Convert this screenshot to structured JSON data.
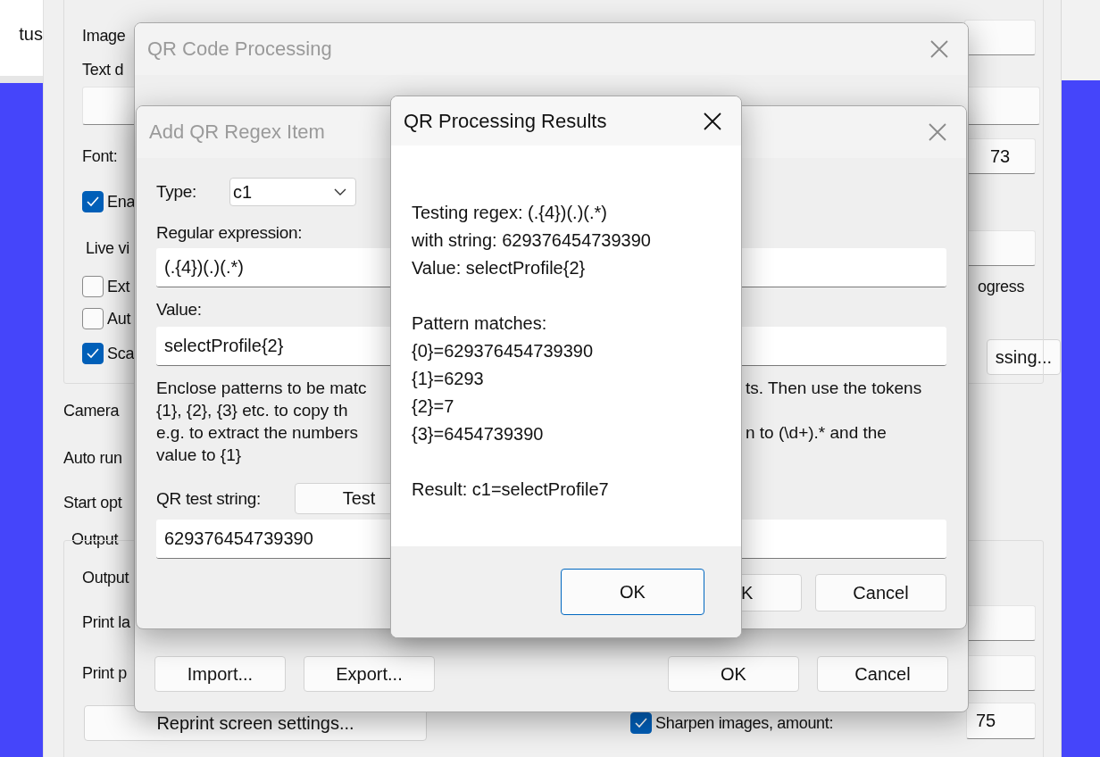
{
  "settings_window": {
    "side_panel_text": "tus",
    "left_items": [
      {
        "kind": "label",
        "text": "Image"
      },
      {
        "kind": "label",
        "text": "Text d"
      },
      {
        "kind": "field"
      },
      {
        "kind": "label",
        "text": "Font:"
      },
      {
        "kind": "checkbox",
        "text": "Ena",
        "checked": true
      },
      {
        "kind": "label",
        "text": "Live vi"
      },
      {
        "kind": "checkbox",
        "text": "Ext",
        "checked": false
      },
      {
        "kind": "checkbox",
        "text": "Aut",
        "checked": false
      },
      {
        "kind": "checkbox",
        "text": "Sca",
        "checked": true
      },
      {
        "kind": "label",
        "text": "Camera"
      },
      {
        "kind": "label",
        "text": "Auto run"
      },
      {
        "kind": "label",
        "text": "Start opt"
      },
      {
        "kind": "group_title",
        "text": "Output"
      },
      {
        "kind": "label",
        "text": "Output"
      },
      {
        "kind": "label",
        "text": "Print la"
      },
      {
        "kind": "label",
        "text": "Print p"
      },
      {
        "kind": "button",
        "text": "Reprint screen settings..."
      }
    ],
    "right_items": [
      {
        "kind": "field"
      },
      {
        "kind": "field"
      },
      {
        "kind": "field",
        "value": "73"
      },
      {
        "kind": "field"
      },
      {
        "kind": "label",
        "text": "ogress"
      },
      {
        "kind": "button",
        "text": "ssing..."
      },
      {
        "kind": "field"
      },
      {
        "kind": "field"
      },
      {
        "kind": "field",
        "value": "75"
      }
    ],
    "sharpen": {
      "text": "Sharpen images, amount:",
      "checked": true
    }
  },
  "qr_window": {
    "title": "QR Code Processing",
    "left_buttons": [
      "Import...",
      "Export..."
    ],
    "right_buttons": [
      "OK",
      "Cancel"
    ]
  },
  "regex_window": {
    "title": "Add QR Regex Item",
    "type_label": "Type:",
    "type_value": "c1",
    "regex_label": "Regular expression:",
    "regex_value": "(.{4})(.)(.*)",
    "value_label": "Value:",
    "value_value": "selectProfile{2}",
    "help_lines": [
      {
        "left": "Enclose patterns to be matc",
        "right": "ts. Then use the tokens"
      },
      {
        "left": "{1}, {2}, {3} etc. to copy th"
      },
      {
        "left": "e.g. to extract the numbers",
        "right": "n to (\\d+).* and the"
      },
      {
        "left": "value to {1}"
      }
    ],
    "test_label": "QR test string:",
    "test_button": "Test",
    "test_value": "629376454739390",
    "buttons": [
      "K",
      "Cancel"
    ]
  },
  "results_window": {
    "title": "QR Processing Results",
    "paragraphs": [
      [
        "Testing regex: (.{4})(.)(.*)",
        "with string: 629376454739390",
        "Value: selectProfile{2}"
      ],
      [
        "Pattern matches:",
        "{0}=629376454739390",
        "{1}=6293",
        "{2}=7",
        "{3}=6454739390"
      ],
      [
        "Result: c1=selectProfile7"
      ]
    ],
    "ok_button": "OK"
  }
}
